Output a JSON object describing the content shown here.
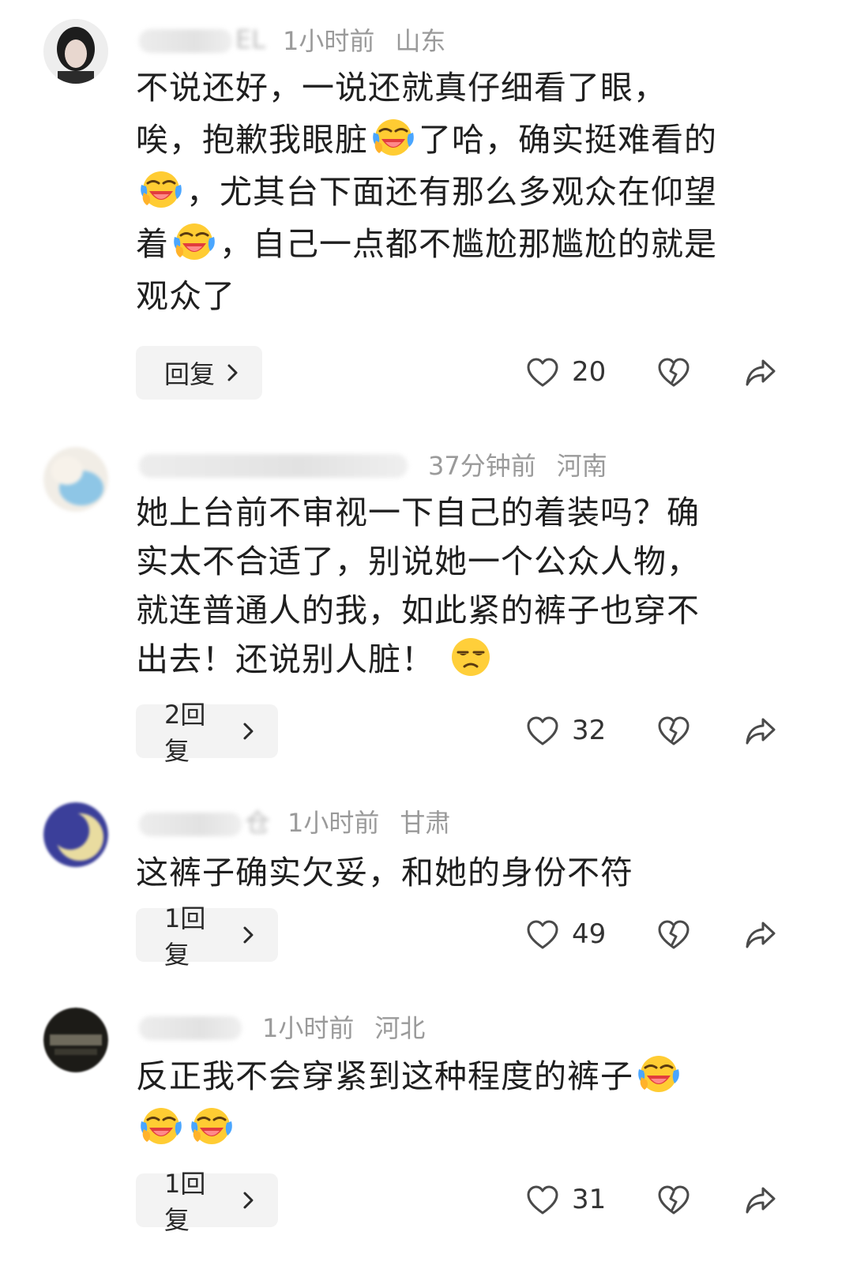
{
  "comments": [
    {
      "username_fragment": "EL",
      "time": "1小时前",
      "location": "山东",
      "lines": [
        "不说还好，一说还就真仔细看了眼，",
        "唉，抱歉我眼脏",
        "了哈，确实挺难看的",
        "，尤其台下面还有那么多观众在仰望",
        "着",
        "，自己一点都不尴尬那尴尬的就是",
        "观众了"
      ],
      "reply_label": "回复",
      "likes": "20",
      "emoji": "face-with-tears-of-joy"
    },
    {
      "username_fragment": "",
      "time": "37分钟前",
      "location": "河南",
      "lines": [
        "她上台前不审视一下自己的着装吗？确",
        "实太不合适了，别说她一个公众人物，",
        "就连普通人的我，如此紧的裤子也穿不",
        "出去！还说别人脏！"
      ],
      "reply_label": "2回复",
      "likes": "32",
      "emoji": "unamused-face"
    },
    {
      "username_fragment": "仓",
      "time": "1小时前",
      "location": "甘肃",
      "lines": [
        "这裤子确实欠妥，和她的身份不符"
      ],
      "reply_label": "1回复",
      "likes": "49"
    },
    {
      "username_fragment": "",
      "time": "1小时前",
      "location": "河北",
      "lines": [
        "反正我不会穿紧到这种程度的裤子"
      ],
      "reply_label": "1回复",
      "likes": "31",
      "emoji": "face-with-tears-of-joy"
    }
  ],
  "icons": {
    "like": "heart-outline-icon",
    "dislike": "broken-heart-icon",
    "share": "share-arrow-icon",
    "chevron": "chevron-right-icon"
  },
  "colors": {
    "text": "#1f1f1f",
    "meta": "#9a9a9a",
    "reply_bg": "#f3f3f3",
    "icon": "#4a4a4a"
  }
}
